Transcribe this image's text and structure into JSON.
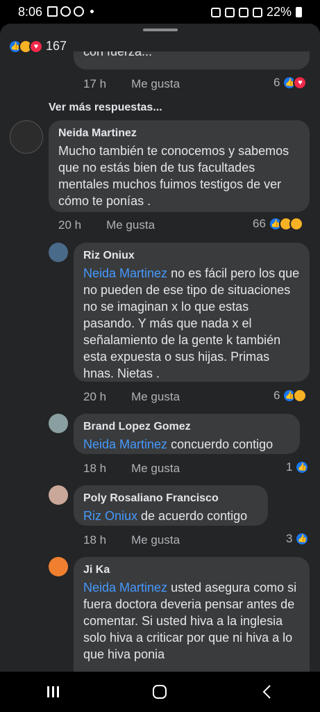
{
  "status_bar": {
    "time": "8:06",
    "battery": "22%"
  },
  "header": {
    "reaction_count": "167"
  },
  "top_comment": {
    "partial_text": "con fuerza...",
    "time": "17 h",
    "like_label": "Me gusta",
    "reactions": "6"
  },
  "more_replies_label": "Ver más respuestas...",
  "comments": [
    {
      "author": "Neida Martinez",
      "text": "Mucho también te conocemos y sabemos que no estás bien de tus facultades mentales muchos fuimos testigos de ver cómo te ponías .",
      "time": "20 h",
      "like_label": "Me gusta",
      "reactions": "66"
    },
    {
      "author": "Riz Oniux",
      "mention": "Neida Martinez",
      "text": " no es fácil pero los que no pueden de ese tipo de situaciones no se imaginan x lo que estas pasando. Y más que nada x el señalamiento de la gente k también esta expuesta o sus hijas. Primas hnas. Nietas .",
      "time": "20 h",
      "like_label": "Me gusta",
      "reactions": "6"
    },
    {
      "author": "Brand Lopez Gomez",
      "mention": "Neida Martinez",
      "text": " concuerdo contigo",
      "time": "18 h",
      "like_label": "Me gusta",
      "reactions": "1"
    },
    {
      "author": "Poly Rosaliano Francisco",
      "mention": "Riz Oniux",
      "text": " de acuerdo contigo",
      "time": "18 h",
      "like_label": "Me gusta",
      "reactions": "3"
    },
    {
      "author": "Ji Ka",
      "mention": "Neida Martinez",
      "text": "  usted asegura como si fuera doctora deveria pensar antes de comentar. Si usted hiva a la inglesia solo hiva a criticar por que ni hiva a lo que hiva ponia"
    }
  ],
  "colors": {
    "bubble": "#3a3b3c",
    "background": "#242526",
    "mention": "#4599ff",
    "like": "#1877f2"
  },
  "icons": [
    "like-icon",
    "sad-icon",
    "love-icon",
    "haha-icon",
    "wow-icon"
  ]
}
